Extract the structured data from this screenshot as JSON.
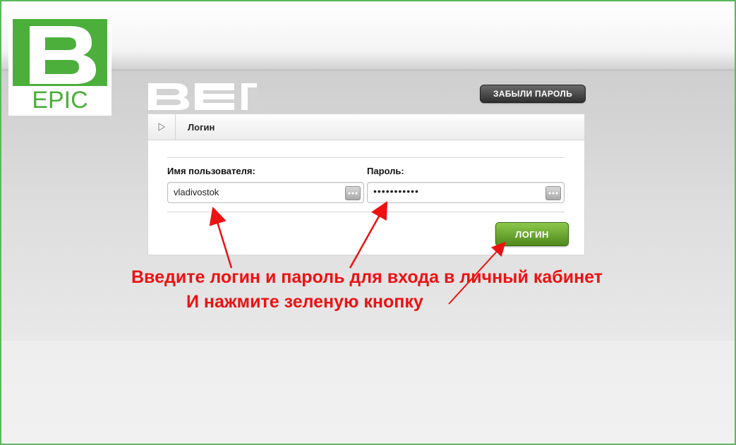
{
  "logo": {
    "text": "EPIC",
    "icon": "b-epic-logo"
  },
  "brand_mark": {
    "icon": "bei-mark"
  },
  "forgot_button": {
    "label": "ЗАБЫЛИ ПАРОЛЬ"
  },
  "panel": {
    "title": "Логин",
    "toggle_icon": "triangle-right-icon"
  },
  "username": {
    "label": "Имя пользователя:",
    "value": "vladivostok"
  },
  "password": {
    "label": "Пароль:",
    "value": "•••••••••••"
  },
  "login_button": {
    "label": "ЛОГИН"
  },
  "annotation": {
    "line1": "Введите логин и пароль для входа в личный кабинет",
    "line2": "И нажмите зеленую кнопку",
    "color": "#ee1111"
  },
  "colors": {
    "frame_border": "#5cb85c",
    "logo_green": "#4caf3c",
    "login_green": "#6aaa30"
  }
}
